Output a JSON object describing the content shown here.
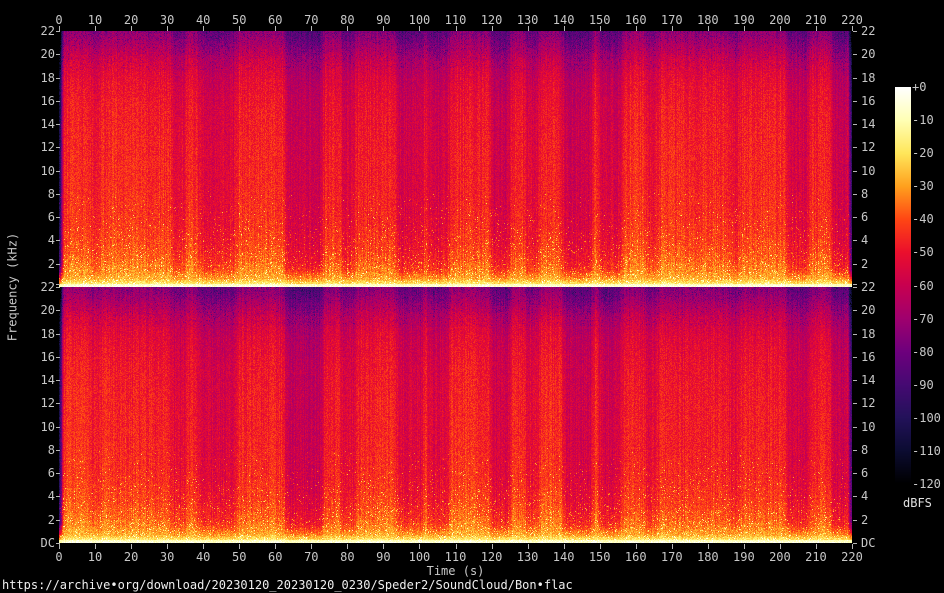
{
  "footer": {
    "url": "https://archive•org/download/20230120_20230120_0230/Speder2/SoundCloud/Bon•flac"
  },
  "axis_color": "#c8c8c8",
  "chart_data": {
    "type": "heatmap",
    "variant": "stereo-audio-spectrogram",
    "title": "https://archive•org/download/20230120_20230120_0230/Speder2/SoundCloud/Bon•flac",
    "channels": 2,
    "channel_order": [
      "left",
      "right"
    ],
    "x_axis": {
      "label": "Time (s)",
      "min": 0,
      "max": 220,
      "tick_labels": [
        "0",
        "10",
        "20",
        "30",
        "40",
        "50",
        "60",
        "70",
        "80",
        "90",
        "100",
        "110",
        "120",
        "130",
        "140",
        "150",
        "160",
        "170",
        "180",
        "190",
        "200",
        "210",
        "220"
      ]
    },
    "y_axis": {
      "label": "Frequency (kHz)",
      "max_khz": 22,
      "step_khz": 2,
      "tick_labels": [
        "22",
        "20",
        "18",
        "16",
        "14",
        "12",
        "10",
        "8",
        "6",
        "4",
        "2"
      ],
      "dc_label": "DC"
    },
    "colorbar": {
      "label": "dBFS",
      "max_db": 0,
      "min_db": -120,
      "tick_labels": [
        "+0",
        "-10",
        "-20",
        "-30",
        "-40",
        "-50",
        "-60",
        "-70",
        "-80",
        "-90",
        "-100",
        "-110",
        "-120"
      ]
    },
    "palette_stops_db_rgb": [
      [
        0,
        [
          255,
          255,
          255
        ]
      ],
      [
        -10,
        [
          255,
          255,
          180
        ]
      ],
      [
        -20,
        [
          255,
          230,
          90
        ]
      ],
      [
        -30,
        [
          255,
          160,
          30
        ]
      ],
      [
        -40,
        [
          255,
          70,
          20
        ]
      ],
      [
        -50,
        [
          235,
          15,
          45
        ]
      ],
      [
        -60,
        [
          200,
          0,
          80
        ]
      ],
      [
        -70,
        [
          160,
          0,
          110
        ]
      ],
      [
        -80,
        [
          110,
          0,
          125
        ]
      ],
      [
        -90,
        [
          70,
          10,
          115
        ]
      ],
      [
        -100,
        [
          35,
          18,
          90
        ]
      ],
      [
        -110,
        [
          12,
          12,
          50
        ]
      ],
      [
        -120,
        [
          0,
          0,
          0
        ]
      ]
    ],
    "frequency_profile_db": [
      [
        0.0,
        -4
      ],
      [
        0.006,
        -8
      ],
      [
        0.012,
        -18
      ],
      [
        0.03,
        -28
      ],
      [
        0.06,
        -33
      ],
      [
        0.1,
        -37
      ],
      [
        0.16,
        -41
      ],
      [
        0.25,
        -44
      ],
      [
        0.4,
        -46
      ],
      [
        0.55,
        -47
      ],
      [
        0.7,
        -49
      ],
      [
        0.8,
        -52
      ],
      [
        0.88,
        -57
      ],
      [
        0.93,
        -64
      ],
      [
        0.97,
        -70
      ],
      [
        1.0,
        -74
      ]
    ],
    "quiet_time_bands": [
      [
        9,
        11,
        4
      ],
      [
        31.5,
        35,
        6
      ],
      [
        39,
        49,
        9
      ],
      [
        63,
        73,
        13
      ],
      [
        78.5,
        82,
        7
      ],
      [
        94,
        101,
        10
      ],
      [
        102.5,
        108,
        10
      ],
      [
        120,
        125,
        11
      ],
      [
        129.5,
        133,
        7
      ],
      [
        140,
        148,
        13
      ],
      [
        150,
        156,
        12
      ],
      [
        163,
        166,
        6
      ],
      [
        186,
        189,
        5
      ],
      [
        202,
        208,
        10
      ],
      [
        214.5,
        218.5,
        12
      ]
    ],
    "lead_silence_s": 0.8,
    "tail_fade_start_s": 218.5
  }
}
